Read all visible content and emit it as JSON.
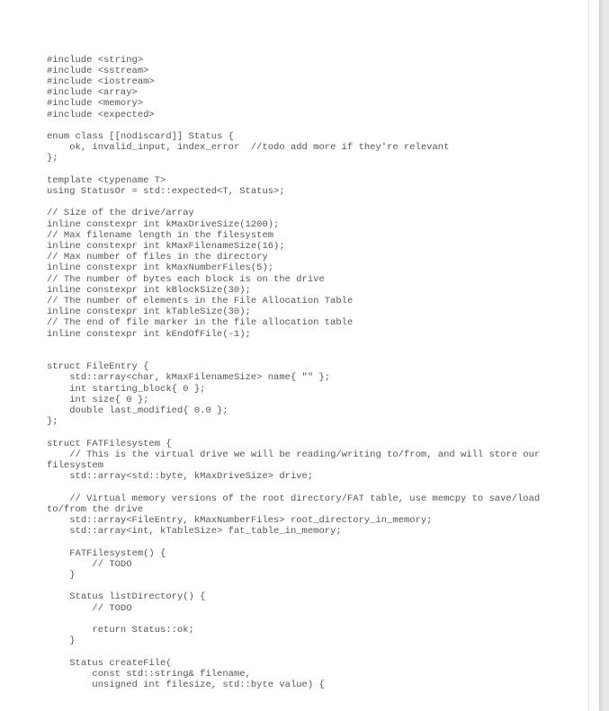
{
  "code": {
    "lines": [
      "#include <string>",
      "#include <sstream>",
      "#include <iostream>",
      "#include <array>",
      "#include <memory>",
      "#include <expected>",
      "",
      "enum class [[nodiscard]] Status {",
      "    ok, invalid_input, index_error  //todo add more if they're relevant",
      "};",
      "",
      "template <typename T>",
      "using StatusOr = std::expected<T, Status>;",
      "",
      "// Size of the drive/array",
      "inline constexpr int kMaxDriveSize(1200);",
      "// Max filename length in the filesystem",
      "inline constexpr int kMaxFilenameSize(16);",
      "// Max number of files in the directory",
      "inline constexpr int kMaxNumberFiles(5);",
      "// The number of bytes each block is on the drive",
      "inline constexpr int kBlockSize(30);",
      "// The number of elements in the File Allocation Table",
      "inline constexpr int kTableSize(30);",
      "// The end of file marker in the file allocation table",
      "inline constexpr int kEndOfFile(-1);",
      "",
      "",
      "struct FileEntry {",
      "    std::array<char, kMaxFilenameSize> name{ \"\" };",
      "    int starting_block{ 0 };",
      "    int size{ 0 };",
      "    double last_modified{ 0.0 };",
      "};",
      "",
      "struct FATFilesystem {",
      "    // This is the virtual drive we will be reading/writing to/from, and will store our filesystem",
      "    std::array<std::byte, kMaxDriveSize> drive;",
      "",
      "    // Virtual memory versions of the root directory/FAT table, use memcpy to save/load to/from the drive",
      "    std::array<FileEntry, kMaxNumberFiles> root_directory_in_memory;",
      "    std::array<int, kTableSize> fat_table_in_memory;",
      "",
      "    FATFilesystem() {",
      "        // TODO",
      "    }",
      "",
      "    Status listDirectory() {",
      "        // TODO",
      "",
      "        return Status::ok;",
      "    }",
      "",
      "    Status createFile(",
      "        const std::string& filename,",
      "        unsigned int filesize, std::byte value) {"
    ]
  }
}
